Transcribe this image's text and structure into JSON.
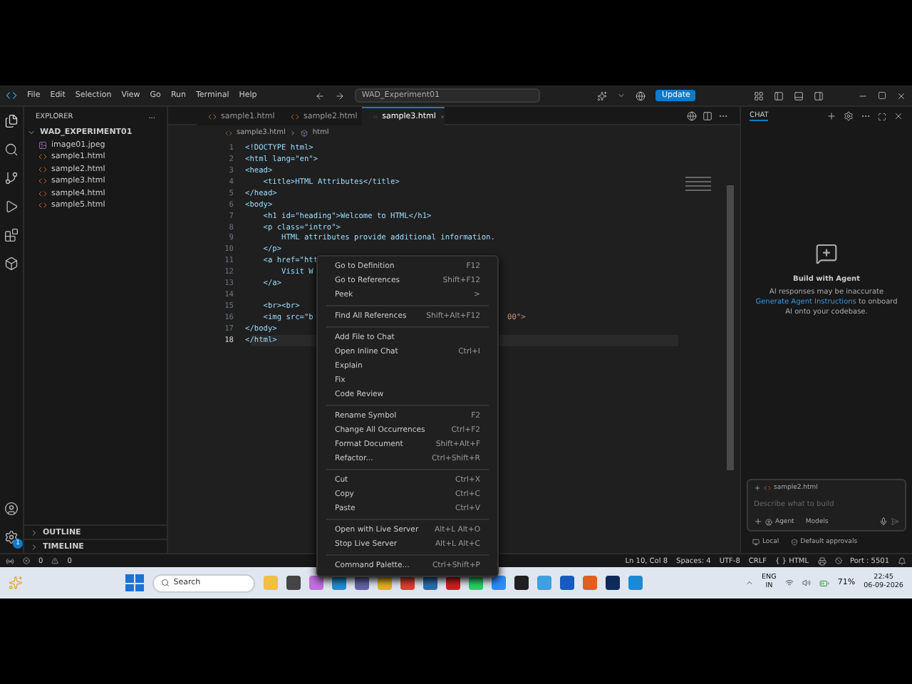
{
  "title_bar": {
    "menus": [
      "File",
      "Edit",
      "Selection",
      "View",
      "Go",
      "Run",
      "Terminal",
      "Help"
    ],
    "search": "WAD_Experiment01",
    "update_button": "Update"
  },
  "sidebar": {
    "title": "EXPLORER",
    "more": "...",
    "folder": "WAD_EXPERIMENT01",
    "files": [
      {
        "name": "image01.jpeg",
        "kind": "image"
      },
      {
        "name": "sample1.html",
        "kind": "html"
      },
      {
        "name": "sample2.html",
        "kind": "html"
      },
      {
        "name": "sample3.html",
        "kind": "html"
      },
      {
        "name": "sample4.html",
        "kind": "html"
      },
      {
        "name": "sample5.html",
        "kind": "html"
      }
    ],
    "sections": [
      "OUTLINE",
      "TIMELINE"
    ],
    "settings_badge": "1"
  },
  "tabs": [
    {
      "label": "sample1.html",
      "selected": false
    },
    {
      "label": "sample2.html",
      "selected": false
    },
    {
      "label": "sample3.html",
      "selected": true
    }
  ],
  "breadcrumb": [
    "sample3.html",
    "html"
  ],
  "code": [
    {
      "number": "1",
      "text": "<!DOCTYPE html>"
    },
    {
      "number": "2",
      "text": "<html lang=\"en\">"
    },
    {
      "number": "3",
      "text": "<head>"
    },
    {
      "number": "4",
      "text": "    <title>HTML Attributes</title>"
    },
    {
      "number": "5",
      "text": "</head>"
    },
    {
      "number": "6",
      "text": "<body>"
    },
    {
      "number": "7",
      "text": "    <h1 id=\"heading\">Welcome to HTML</h1>"
    },
    {
      "number": "8",
      "text": "    <p class=\"intro\">"
    },
    {
      "number": "9",
      "text": "        HTML attributes provide additional information."
    },
    {
      "number": "10",
      "text": "    </p>"
    },
    {
      "number": "11",
      "text": "    <a href=\"htt"
    },
    {
      "number": "12",
      "text": "        Visit W"
    },
    {
      "number": "13",
      "text": "    </a>"
    },
    {
      "number": "14"
    },
    {
      "number": "15",
      "text": "    <br><br>"
    },
    {
      "number": "16",
      "text": "    <img src=\"b",
      "tail": "00\">"
    },
    {
      "number": "17",
      "text": "</body>"
    },
    {
      "number": "18",
      "text": "</html>"
    }
  ],
  "context_menu": [
    [
      {
        "label": "Go to Definition",
        "shortcut": "F12"
      },
      {
        "label": "Go to References",
        "shortcut": "Shift+F12"
      },
      {
        "label": "Peek",
        "shortcut": ">"
      }
    ],
    [
      {
        "label": "Find All References",
        "shortcut": "Shift+Alt+F12"
      }
    ],
    [
      {
        "label": "Add File to Chat"
      },
      {
        "label": "Open Inline Chat",
        "shortcut": "Ctrl+I"
      },
      {
        "label": "Explain"
      },
      {
        "label": "Fix"
      },
      {
        "label": "Code Review"
      }
    ],
    [
      {
        "label": "Rename Symbol",
        "shortcut": "F2"
      },
      {
        "label": "Change All Occurrences",
        "shortcut": "Ctrl+F2"
      },
      {
        "label": "Format Document",
        "shortcut": "Shift+Alt+F"
      },
      {
        "label": "Refactor...",
        "shortcut": "Ctrl+Shift+R"
      }
    ],
    [
      {
        "label": "Cut",
        "shortcut": "Ctrl+X"
      },
      {
        "label": "Copy",
        "shortcut": "Ctrl+C"
      },
      {
        "label": "Paste",
        "shortcut": "Ctrl+V"
      }
    ],
    [
      {
        "label": "Open with Live Server",
        "shortcut": "Alt+L Alt+O"
      },
      {
        "label": "Stop Live Server",
        "shortcut": "Alt+L Alt+C"
      }
    ],
    [
      {
        "label": "Command Palette...",
        "shortcut": "Ctrl+Shift+P"
      }
    ]
  ],
  "chat": {
    "tab": "CHAT",
    "heading": "Build with Agent",
    "line1": "AI responses may be inaccurate",
    "link": "Generate Agent Instructions",
    "line2": "to onboard AI onto your codebase.",
    "attachment": "sample2.html",
    "placeholder": "Describe what to build",
    "mode": "Agent",
    "models": "Models",
    "footer": [
      "Local",
      "Default approvals"
    ]
  },
  "status_bar": {
    "errors": "0",
    "warnings": "0",
    "items": [
      "Ln 10, Col 8",
      "Spaces: 4",
      "UTF-8",
      "CRLF",
      "{ } HTML"
    ],
    "port": "Port : 5501"
  },
  "taskbar": {
    "search": "Search",
    "apps": [
      {
        "color": "#f0c040"
      },
      {
        "color": "#444444"
      },
      {
        "color": "#c070e0"
      },
      {
        "color": "#1e90d0"
      },
      {
        "color": "#6264a7"
      },
      {
        "color": "#e8b020"
      },
      {
        "color": "#e04030"
      },
      {
        "color": "#2a6fb0"
      },
      {
        "color": "#d02020"
      },
      {
        "color": "#25d366"
      },
      {
        "color": "#2d8cff"
      },
      {
        "color": "#202020"
      },
      {
        "color": "#40a0e0"
      },
      {
        "color": "#185abd"
      },
      {
        "color": "#e06020"
      },
      {
        "color": "#0e2a5a"
      },
      {
        "color": "#1a8ad4"
      }
    ],
    "lang": [
      "ENG",
      "IN"
    ],
    "battery": "71%",
    "time": "22:45",
    "date": "06-09-2026"
  }
}
